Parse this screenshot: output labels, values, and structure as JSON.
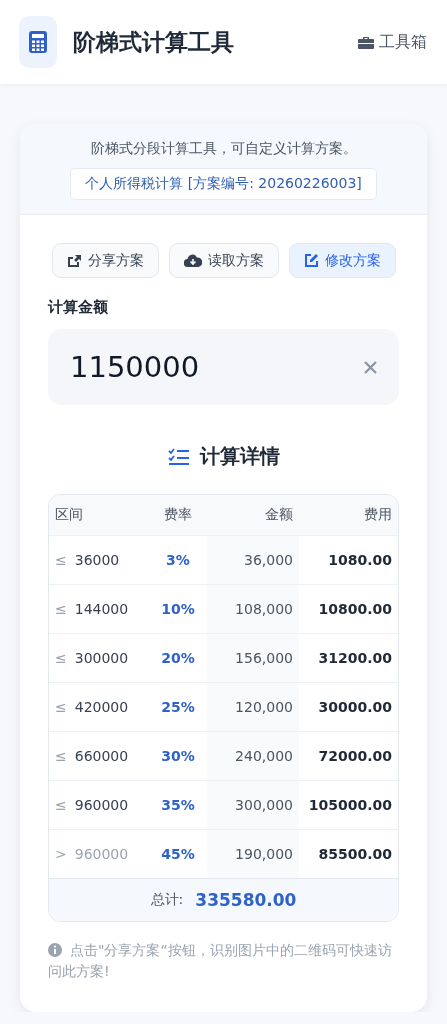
{
  "header": {
    "title": "阶梯式计算工具",
    "toolbox": "工具箱"
  },
  "intro": {
    "description": "阶梯式分段计算工具，可自定义计算方案。",
    "scheme": "个人所得税计算 [方案编号: 20260226003]"
  },
  "actions": [
    {
      "kind": "share",
      "label": "分享方案",
      "selected": false
    },
    {
      "kind": "load",
      "label": "读取方案",
      "selected": false
    },
    {
      "kind": "edit",
      "label": "修改方案",
      "selected": true
    }
  ],
  "amount": {
    "label": "计算金额",
    "value": "1150000"
  },
  "details": {
    "title": "计算详情",
    "columns": [
      "区间",
      "费率",
      "金额",
      "费用"
    ],
    "rows": [
      {
        "op": "≤",
        "limit": "36000",
        "rate": "3%",
        "amount": "36,000",
        "fee": "1080.00",
        "muted": false
      },
      {
        "op": "≤",
        "limit": "144000",
        "rate": "10%",
        "amount": "108,000",
        "fee": "10800.00",
        "muted": false
      },
      {
        "op": "≤",
        "limit": "300000",
        "rate": "20%",
        "amount": "156,000",
        "fee": "31200.00",
        "muted": false
      },
      {
        "op": "≤",
        "limit": "420000",
        "rate": "25%",
        "amount": "120,000",
        "fee": "30000.00",
        "muted": false
      },
      {
        "op": "≤",
        "limit": "660000",
        "rate": "30%",
        "amount": "240,000",
        "fee": "72000.00",
        "muted": false
      },
      {
        "op": "≤",
        "limit": "960000",
        "rate": "35%",
        "amount": "300,000",
        "fee": "105000.00",
        "muted": false
      },
      {
        "op": ">",
        "limit": "960000",
        "rate": "45%",
        "amount": "190,000",
        "fee": "85500.00",
        "muted": true
      }
    ],
    "total_label": "总计:",
    "total": "335580.00"
  },
  "note": "点击\"分享方案“按钮，识别图片中的二维码可快速访问此方案!"
}
